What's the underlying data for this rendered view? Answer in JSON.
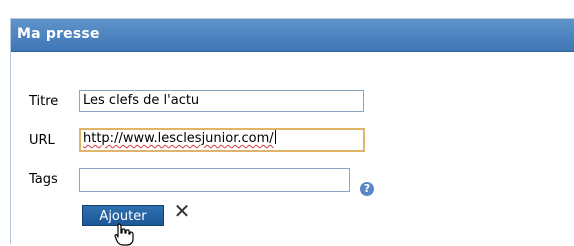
{
  "panel": {
    "title": "Ma presse"
  },
  "form": {
    "title_label": "Titre",
    "title_value": "Les clefs de l'actu",
    "url_label": "URL",
    "url_value": "http://www.lesclesjunior.com/",
    "tags_label": "Tags",
    "tags_value": ""
  },
  "actions": {
    "add_label": "Ajouter",
    "help_icon": "help-icon",
    "close_icon": "close-icon",
    "close_glyph": "✕",
    "help_glyph": "?"
  },
  "colors": {
    "header": "#3f77b5",
    "button": "#1d5797",
    "focus_border": "#e0b56b"
  }
}
